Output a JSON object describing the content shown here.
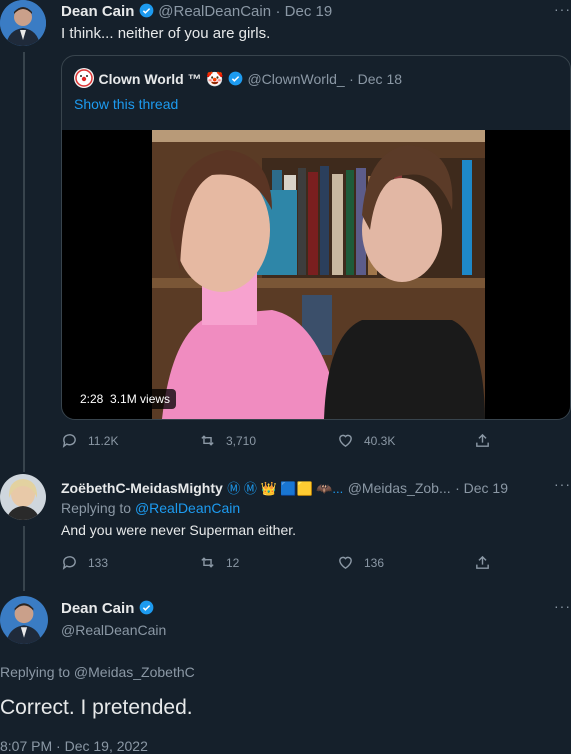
{
  "tweet1": {
    "name": "Dean Cain",
    "handle": "@RealDeanCain",
    "date": "· Dec 19",
    "text": "I think... neither of you are girls.",
    "quote": {
      "name": "Clown World ™",
      "emoji": "🤡",
      "handle": "@ClownWorld_",
      "date": "· Dec 18",
      "show_thread": "Show this thread",
      "video_duration": "2:28",
      "video_views": "3.1M views"
    },
    "actions": {
      "replies": "11.2K",
      "retweets": "3,710",
      "likes": "40.3K"
    }
  },
  "tweet2": {
    "name": "ZoëbethC-MeidasMighty",
    "name_icons": "Ⓜ Ⓜ 👑 🟦🟨 🦇...",
    "handle": "@Meidas_Zob...",
    "date": "· Dec 19",
    "replying_prefix": "Replying to",
    "replying_to": "@RealDeanCain",
    "text": "And you were never Superman either.",
    "actions": {
      "replies": "133",
      "retweets": "12",
      "likes": "136"
    }
  },
  "tweet3": {
    "name": "Dean Cain",
    "handle": "@RealDeanCain",
    "replying_line": "Replying to @Meidas_ZobethC",
    "text": "Correct. I pretended.",
    "timestamp": "8:07 PM · Dec 19, 2022"
  },
  "colors": {
    "background": "#15202b",
    "accent": "#1d9bf0",
    "muted": "#8b98a5",
    "border": "#38444d"
  }
}
